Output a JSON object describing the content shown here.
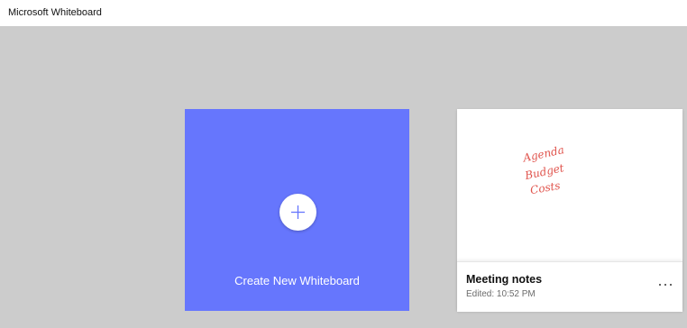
{
  "window": {
    "title": "Microsoft Whiteboard"
  },
  "create_card": {
    "label": "Create New Whiteboard",
    "icon": "plus-icon",
    "color": "#6676fd"
  },
  "boards": [
    {
      "name": "Meeting notes",
      "edited": "Edited: 10:52 PM",
      "ink_lines": [
        "Agenda",
        "Budget",
        "Costs"
      ],
      "ink_color": "#e0534c",
      "more_icon": "more-options-icon"
    }
  ],
  "colors": {
    "background": "#cccccc",
    "titlebar": "#ffffff"
  }
}
